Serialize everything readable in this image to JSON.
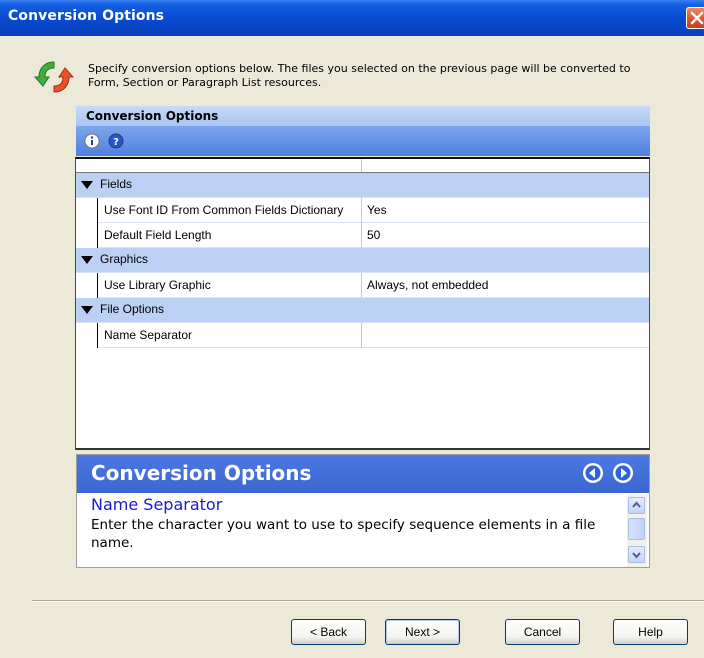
{
  "window": {
    "title": "Conversion Options"
  },
  "header": {
    "description": "Specify conversion options below.  The files you selected on the previous page will be converted to Form, Section or Paragraph List resources."
  },
  "options_panel": {
    "title": "Conversion Options"
  },
  "property_grid": {
    "sections": [
      {
        "category": "Fields",
        "properties": [
          {
            "name": "Use Font ID From Common Fields Dictionary",
            "value": "Yes"
          },
          {
            "name": "Default Field Length",
            "value": "50"
          }
        ]
      },
      {
        "category": "Graphics",
        "properties": [
          {
            "name": "Use Library Graphic",
            "value": "Always, not embedded"
          }
        ]
      },
      {
        "category": "File Options",
        "properties": [
          {
            "name": "Name Separator",
            "value": ""
          }
        ]
      }
    ]
  },
  "help_panel": {
    "title": "Conversion Options",
    "subtitle": "Name Separator",
    "description": "Enter the character you want to use to specify sequence elements in a file name."
  },
  "buttons": {
    "back": "< Back",
    "next": "Next >",
    "cancel": "Cancel",
    "help": "Help"
  },
  "colors": {
    "titlebar": "#0a4fd6",
    "category_row": "#bcd0f3",
    "help_header": "#4a78e0",
    "help_subtitle": "#1a1ad0"
  },
  "icons": [
    "close-icon",
    "convert-arrows-icon",
    "properties-icon",
    "help-icon",
    "nav-back-icon",
    "nav-forward-icon",
    "scroll-up-icon",
    "scroll-down-icon"
  ]
}
